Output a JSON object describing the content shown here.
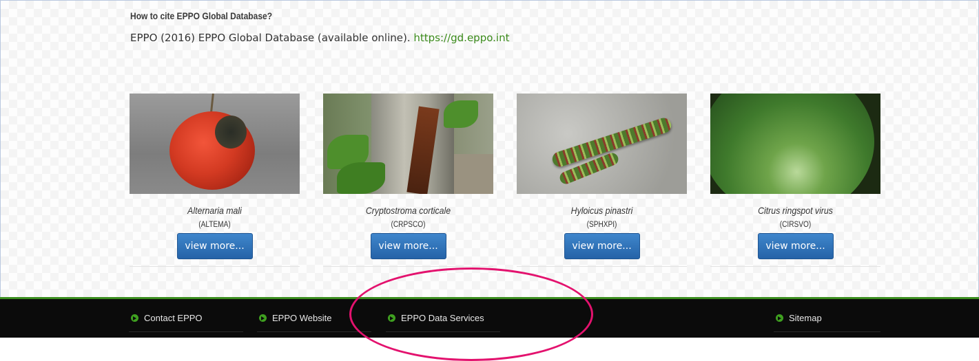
{
  "cite": {
    "heading": "How to cite EPPO Global Database?",
    "text": "EPPO (2016) EPPO Global Database (available online).",
    "url": "https://gd.eppo.int"
  },
  "cards": [
    {
      "name": "Alternaria mali",
      "code": "(ALTEMA)",
      "button": "view more..."
    },
    {
      "name": "Cryptostroma corticale",
      "code": "(CRPSCO)",
      "button": "view more..."
    },
    {
      "name": "Hyloicus pinastri",
      "code": "(SPHXPI)",
      "button": "view more..."
    },
    {
      "name": "Citrus ringspot virus",
      "code": "(CIRSVO)",
      "button": "view more..."
    }
  ],
  "footer": {
    "links": [
      "Contact EPPO",
      "EPPO Website",
      "EPPO Data Services",
      "Sitemap"
    ],
    "accent": "#3fa020"
  },
  "annotation": {
    "color": "#e3126e"
  }
}
